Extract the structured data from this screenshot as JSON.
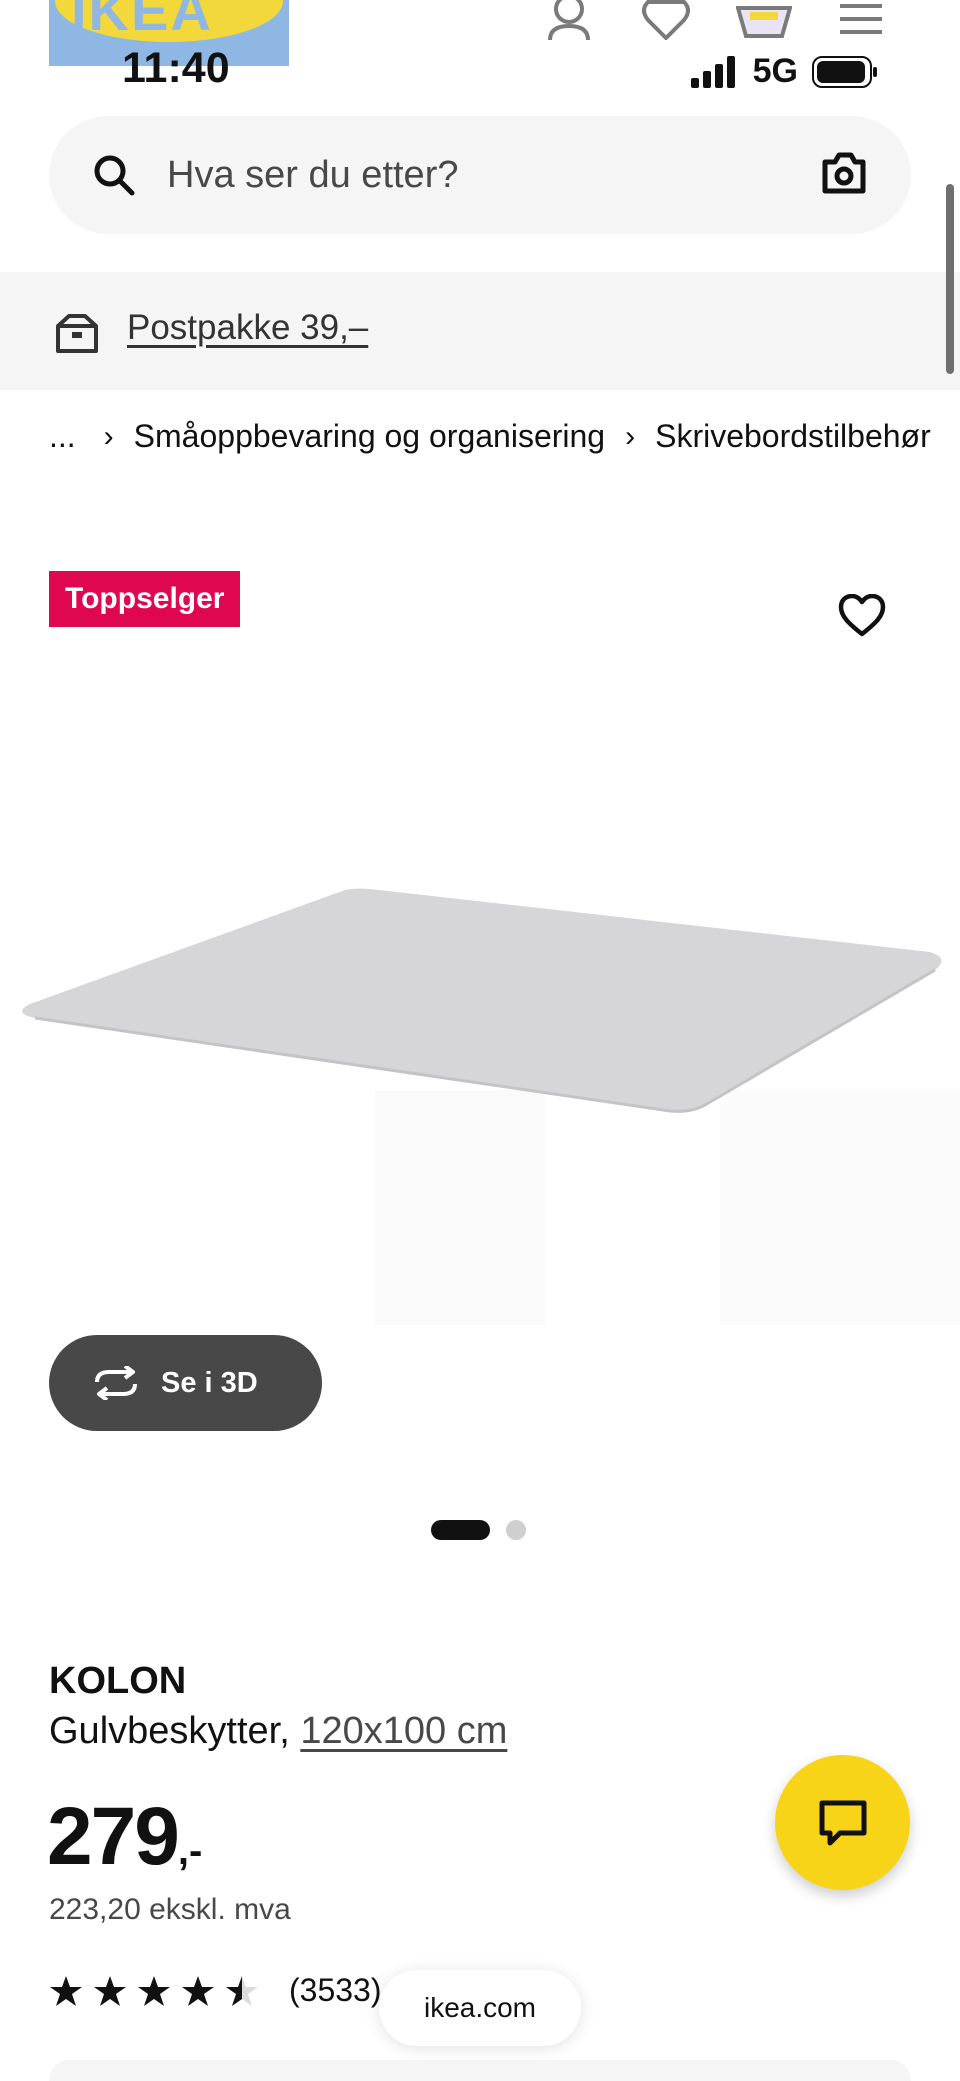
{
  "brand": {
    "logo_text": "IKEA"
  },
  "status_bar": {
    "time": "11:40",
    "network": "5G"
  },
  "header": {
    "icons": [
      "profile-icon",
      "heart-icon",
      "basket-icon",
      "menu-icon"
    ]
  },
  "search": {
    "placeholder": "Hva ser du etter?",
    "icons": [
      "search-icon",
      "camera-icon"
    ]
  },
  "delivery": {
    "label": "Postpakke 39,–",
    "icon": "delivery-box-icon"
  },
  "breadcrumb": {
    "items": [
      "...",
      "Småoppbevaring og organisering",
      "Skrivebordstilbehør"
    ]
  },
  "product": {
    "badge": "Toppselger",
    "view_3d_label": "Se i 3D",
    "carousel": {
      "total": 2,
      "active": 1
    },
    "name": "KOLON",
    "type": "Gulvbeskytter,",
    "size": "120x100 cm",
    "price": "279",
    "price_suffix": ",-",
    "price_ex_vat": "223,20 ekskl. mva",
    "rating": 4.5,
    "rating_count": "(3533)"
  },
  "browser": {
    "url": "ikea.com"
  },
  "colors": {
    "badge": "#e00751",
    "chat": "#f7d417",
    "button_dark": "#484848"
  }
}
